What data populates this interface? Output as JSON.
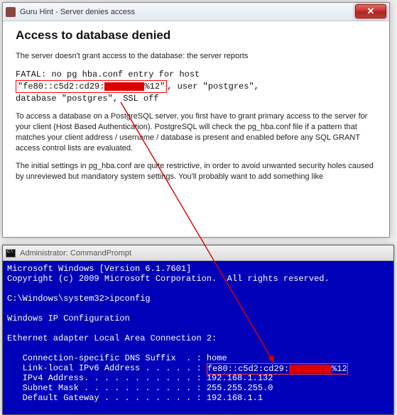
{
  "dialog": {
    "title": "Guru Hint - Server denies access",
    "close_label": "✕",
    "heading": "Access to database denied",
    "intro": "The server doesn't grant access to the database: the server reports",
    "error_line1_a": "FATAL:  no pg hba.conf entry for host",
    "error_line2_a": "\"fe80::c5d2:cd29:",
    "error_line2_c": "%12\"",
    "error_line2_rest": ", user \"postgres\",",
    "error_line3": "database \"postgres\", SSL off",
    "para2": "To access a database on a PostgreSQL server, you first have to grant primary access to the server for your client (Host Based Authentication). PostgreSQL will check the pg_hba.conf file if a pattern that matches your client address / username / database is present and enabled before any SQL GRANT access control lists are evaluated.",
    "para3": "The initial settings in pg_hba.conf are quite restrictive, in order to avoid unwanted security holes caused by unreviewed but mandatory system settings. You'll probably want to add something like"
  },
  "console": {
    "title": " Administrator: CommandPrompt",
    "line1": "Microsoft Windows [Version 6.1.7601]",
    "line2": "Copyright (c) 2009 Microsoft Corporation.  All rights reserved.",
    "prompt_line": "C:\\Windows\\system32>ipconfig",
    "header": "Windows IP Configuration",
    "adapter": "Ethernet adapter Local Area Connection 2:",
    "r1": "   Connection-specific DNS Suffix  . : home",
    "r2a": "   Link-local IPv6 Address . . . . . : ",
    "r2b": "fe80::c5d2:cd29:",
    "r2c": "%12",
    "r3": "   IPv4 Address. . . . . . . . . . . : 192.168.1.132",
    "r4": "   Subnet Mask . . . . . . . . . . . : 255.255.255.0",
    "r5": "   Default Gateway . . . . . . . . . : 192.168.1.1"
  }
}
